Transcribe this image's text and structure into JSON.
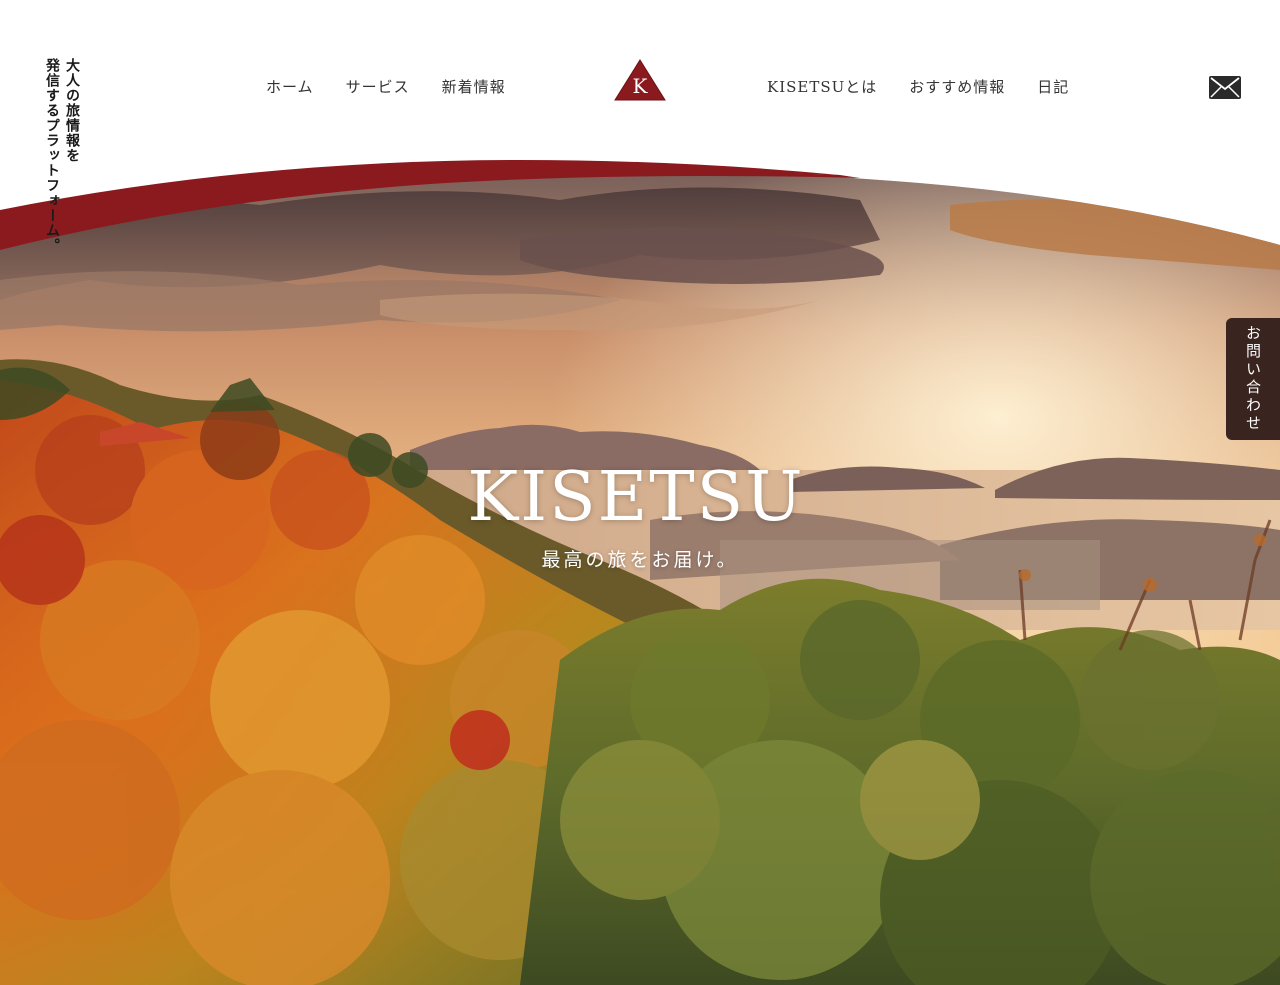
{
  "header": {
    "tagline": "大人の旅情報を\n発信するプラットフォーム。",
    "logo_letter": "K",
    "nav_left": [
      {
        "label": "ホーム"
      },
      {
        "label": "サービス"
      },
      {
        "label": "新着情報"
      }
    ],
    "nav_right": [
      {
        "label": "KISETSUとは"
      },
      {
        "label": "おすすめ情報"
      },
      {
        "label": "日記"
      }
    ],
    "mail_icon": "mail-envelope-icon"
  },
  "hero": {
    "title": "KISETSU",
    "subtitle": "最高の旅をお届け。"
  },
  "contact": {
    "label": "お問い合わせ"
  },
  "colors": {
    "brand": "#8b1a1f",
    "contact_tab": "#3a2420",
    "text": "#333333"
  }
}
